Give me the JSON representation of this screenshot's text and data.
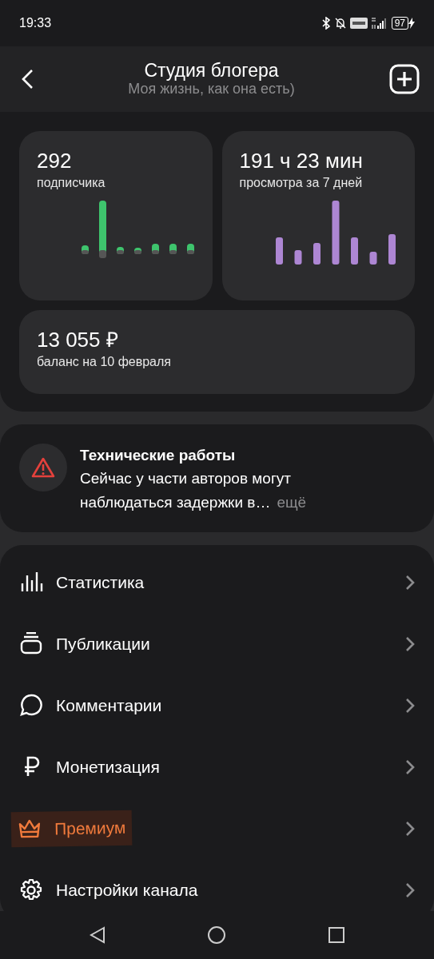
{
  "status_bar": {
    "time": "19:33",
    "battery": "97"
  },
  "header": {
    "title": "Студия блогера",
    "subtitle": "Моя жизнь, как она есть)"
  },
  "stats": [
    {
      "value": "292",
      "label": "подписчика",
      "kind": "subscribers"
    },
    {
      "value": "191 ч 23 мин",
      "label": "просмотра за 7 дней",
      "kind": "views"
    },
    {
      "value": "13 055 ₽",
      "label": "баланс на 10 февраля",
      "kind": "balance"
    }
  ],
  "notice": {
    "title": "Технические работы",
    "lines": [
      "Сейчас у части авторов могут",
      "наблюдаться задержки в…"
    ],
    "more": "ещё"
  },
  "menu": [
    {
      "label": "Статистика",
      "kind": "normal"
    },
    {
      "label": "Публикации",
      "kind": "normal"
    },
    {
      "label": "Комментарии",
      "kind": "normal"
    },
    {
      "label": "Монетизация",
      "kind": "normal"
    },
    {
      "label": "Премиум",
      "kind": "premium"
    },
    {
      "label": "Настройки канала",
      "kind": "normal"
    }
  ]
}
